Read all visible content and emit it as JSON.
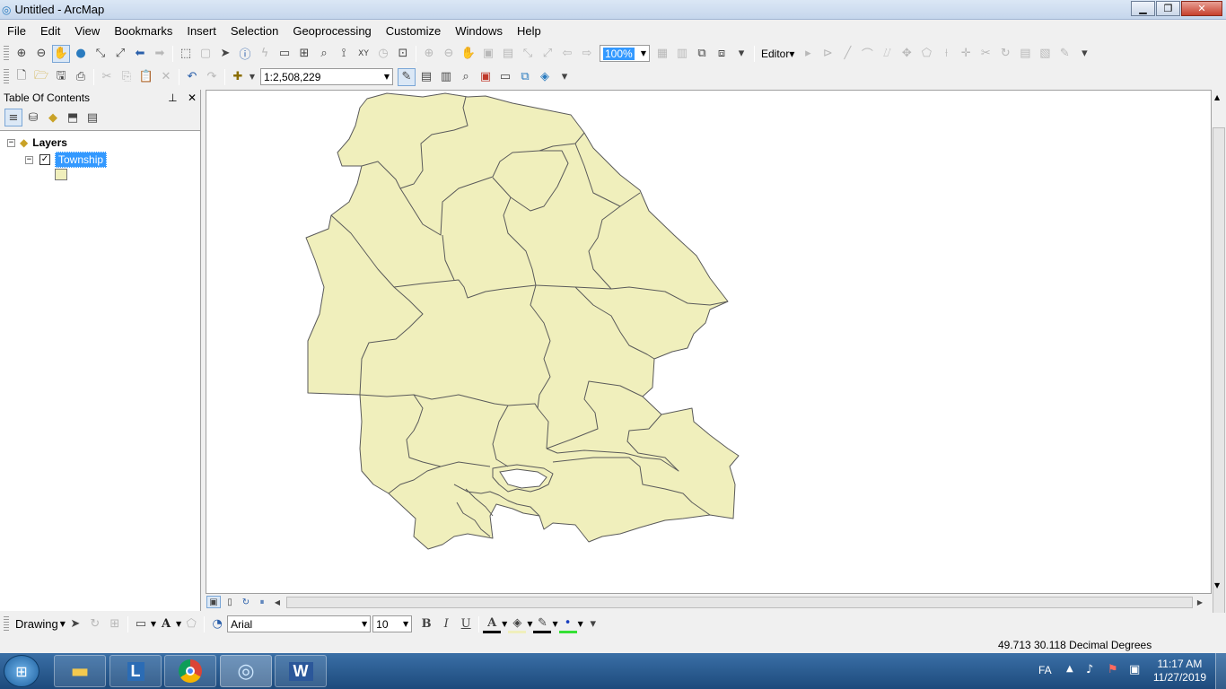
{
  "window": {
    "title": "Untitled - ArcMap"
  },
  "menu": [
    "File",
    "Edit",
    "View",
    "Bookmarks",
    "Insert",
    "Selection",
    "Geoprocessing",
    "Customize",
    "Windows",
    "Help"
  ],
  "toolbar": {
    "zoom_pct": "100%",
    "editor_label": "Editor▾",
    "scale": "1:2,508,229"
  },
  "toc": {
    "title": "Table Of Contents",
    "group": "Layers",
    "layer": "Township",
    "fill_color": "#f0efbc"
  },
  "drawing": {
    "label": "Drawing",
    "font": "Arial",
    "size": "10"
  },
  "status": {
    "coords": "49.713  30.118 Decimal Degrees"
  },
  "taskbar": {
    "lang": "FA",
    "time": "11:17 AM",
    "date": "11/27/2019"
  },
  "map": {
    "fill": "#f0efbc",
    "stroke": "#5a5a5a"
  }
}
